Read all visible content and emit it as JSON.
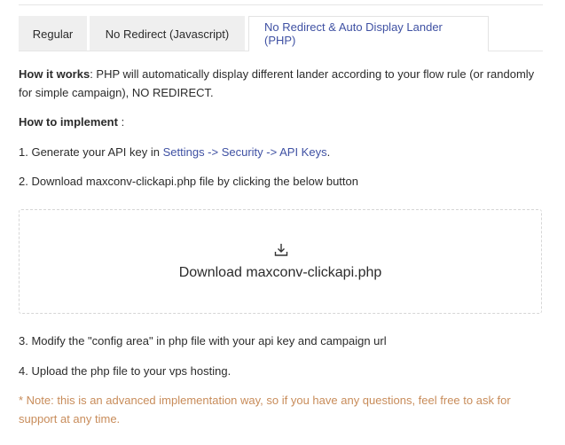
{
  "tabs": [
    {
      "label": "Regular",
      "active": false
    },
    {
      "label": "No Redirect (Javascript)",
      "active": false
    },
    {
      "label": "No Redirect & Auto Display Lander (PHP)",
      "active": true
    }
  ],
  "how_it_works": {
    "heading": "How it works",
    "text": ": PHP will automatically display different lander according to your flow rule (or randomly for simple campaign), NO REDIRECT."
  },
  "how_to_implement": {
    "heading": "How to implement",
    "suffix": " :"
  },
  "step1": {
    "prefix": "1. Generate your API key in ",
    "link": "Settings -> Security -> API Keys",
    "suffix": "."
  },
  "step2": "2. Download maxconv-clickapi.php file by clicking the below button",
  "download": {
    "icon": "download-icon",
    "label": "Download maxconv-clickapi.php"
  },
  "step3": "3. Modify the \"config area\" in php file with your api key and campaign url",
  "step4": "4. Upload the php file to your vps hosting.",
  "note": "* Note: this is an advanced implementation way, so if you have any questions, feel free to ask for support at any time.",
  "colors": {
    "link": "#3f51a3",
    "note": "#c88c5a",
    "tab_inactive_bg": "#efefef",
    "text": "#2b2b2b"
  }
}
